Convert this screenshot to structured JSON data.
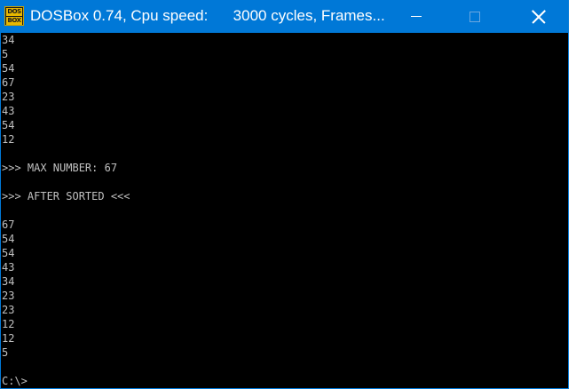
{
  "window": {
    "title": "DOSBox 0.74, Cpu speed:      3000 cycles, Frames...",
    "icon": "dosbox-icon",
    "icon_text_top": "DOS",
    "icon_text_bottom": "BOX",
    "accent_color": "#0078d7"
  },
  "controls": {
    "minimize": "minimize-icon",
    "maximize": "maximize-icon",
    "close": "close-icon"
  },
  "console": {
    "text_color": "#c0c0c0",
    "background": "#000000",
    "output": "34\n5\n54\n67\n23\n43\n54\n12\n\n>>> MAX NUMBER: 67\n\n>>> AFTER SORTED <<<\n\n67\n54\n54\n43\n34\n23\n23\n12\n12\n5\n\nC:\\>"
  }
}
